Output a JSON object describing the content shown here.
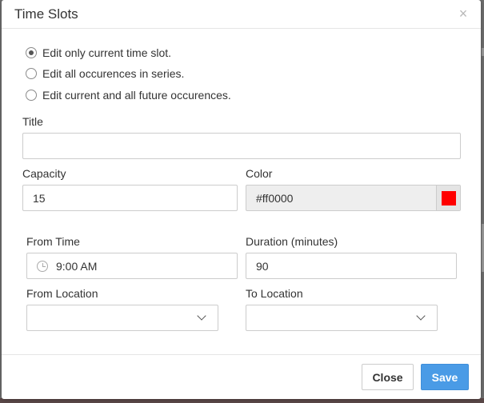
{
  "dialog": {
    "title": "Time Slots",
    "close_symbol": "×"
  },
  "edit_options": [
    {
      "label": "Edit only current time slot.",
      "checked": true
    },
    {
      "label": "Edit all occurences in series.",
      "checked": false
    },
    {
      "label": "Edit current and all future occurences.",
      "checked": false
    }
  ],
  "form": {
    "title_label": "Title",
    "title_value": "",
    "capacity_label": "Capacity",
    "capacity_value": "15",
    "color_label": "Color",
    "color_value": "#ff0000",
    "color_swatch": "#ff0000",
    "from_time_label": "From Time",
    "from_time_value": "9:00 AM",
    "duration_label": "Duration (minutes)",
    "duration_value": "90",
    "from_location_label": "From Location",
    "from_location_value": "",
    "to_location_label": "To Location",
    "to_location_value": ""
  },
  "footer": {
    "close_label": "Close",
    "save_label": "Save"
  },
  "colors": {
    "primary": "#4a9be6",
    "swatch": "#ff0000"
  }
}
